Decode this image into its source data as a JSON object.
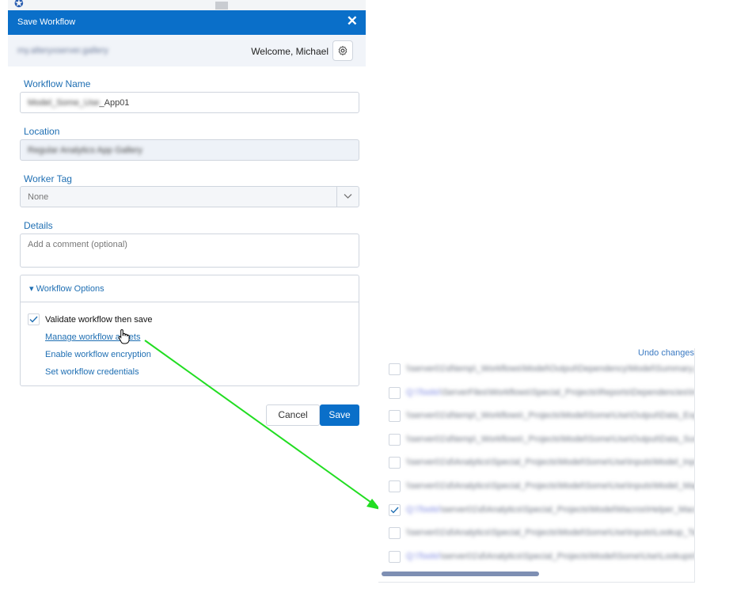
{
  "background": {
    "logo_glyph": "✪"
  },
  "dialog": {
    "title": "Save Workflow",
    "close_glyph": "✕",
    "gallery_url": "my.alteryxserver.gallery",
    "welcome_text": "Welcome, Michael",
    "settings_icon": "gear-icon"
  },
  "form": {
    "workflow_name_label": "Workflow Name",
    "workflow_name_prefix": "Model_Some_Use",
    "workflow_name_suffix": "_App01",
    "location_label": "Location",
    "location_value": "Regular Analytics App Gallery",
    "worker_tag_label": "Worker Tag",
    "worker_tag_value": "None",
    "details_label": "Details",
    "details_placeholder": "Add a comment (optional)"
  },
  "options": {
    "header": "▾ Workflow Options",
    "validate_label": "Validate workflow then save",
    "validate_checked": true,
    "manage_assets": "Manage workflow assets",
    "enable_encryption": "Enable workflow encryption",
    "set_credentials": "Set workflow credentials"
  },
  "buttons": {
    "cancel": "Cancel",
    "save": "Save"
  },
  "colors": {
    "primary": "#0a6fc9",
    "link": "#1f6fb3",
    "arrow": "#22dd22"
  },
  "asset_panel": {
    "undo_label": "Undo changes",
    "rows": [
      {
        "checked": false,
        "prefix": "",
        "path": "\\\\server01\\d\\temp\\_Workflows\\Model\\Output\\Dependency\\Model\\Summary.yxdb"
      },
      {
        "checked": false,
        "prefix": "Q:\\Tools\\",
        "path": "\\ServerFiles\\Workflows\\Special_Projects\\Reports\\Dependencies\\Input.xlsx"
      },
      {
        "checked": false,
        "prefix": "",
        "path": "\\\\server01\\d\\temp\\_Workflows\\_Projects\\Model\\Some\\Use\\Output\\Data_Export.csv"
      },
      {
        "checked": false,
        "prefix": "",
        "path": "\\\\server01\\d\\temp\\_Workflows\\_Projects\\Model\\Some\\Use\\Output\\Data_Summary.csv"
      },
      {
        "checked": false,
        "prefix": "",
        "path": "\\\\server01\\d\\Analytics\\Special_Projects\\Model\\Some\\Use\\Inputs\\Model_Inputs.xlsx"
      },
      {
        "checked": false,
        "prefix": "",
        "path": "\\\\server01\\d\\Analytics\\Special_Projects\\Model\\Some\\Use\\Inputs\\Model_Mapping.xlsx"
      },
      {
        "checked": true,
        "prefix": "Q:\\Tools\\",
        "path": "\\server01\\d\\Analytics\\Special_Projects\\Model\\Macros\\Helper_Macro.yxmc"
      },
      {
        "checked": false,
        "prefix": "",
        "path": "\\\\server01\\d\\Analytics\\Special_Projects\\Model\\Some\\Use\\Inputs\\Lookup_Table.csv"
      },
      {
        "checked": false,
        "prefix": "Q:\\Tools\\",
        "path": "\\server01\\d\\Analytics\\Special_Projects\\Model\\Some\\Use\\Lookups\\Reference.yxdb"
      }
    ]
  }
}
